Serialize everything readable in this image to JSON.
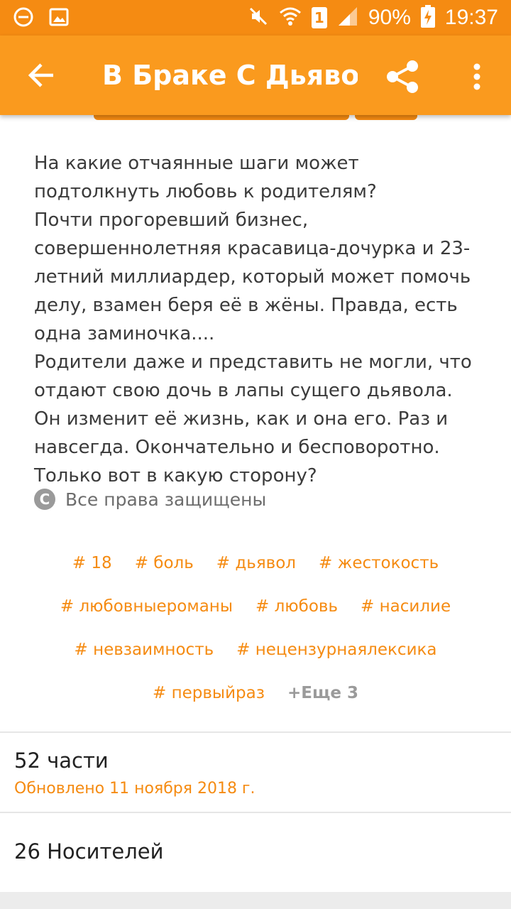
{
  "status_bar": {
    "battery": "90%",
    "time": "19:37",
    "sim_slot": "1"
  },
  "app_bar": {
    "title": "В Браке С Дьяво…"
  },
  "description": "На какие отчаянные шаги может подтолкнуть любовь к родителям?\nПочти прогоревший бизнес, совершеннолетняя красавица-дочурка и 23-летний миллиардер, который может помочь делу, взамен беря её в жёны. Правда, есть одна заминочка....\nРодители даже и представить не могли, что отдают свою дочь в лапы сущего дьявола.\nОн изменит её жизнь, как и она его. Раз и навсегда. Окончательно и бесповоротно.\nТолько вот в какую сторону?",
  "copyright": {
    "symbol": "C",
    "text": "Все права защищены"
  },
  "tags": {
    "row1": [
      "# 18",
      "# боль",
      "# дьявол",
      "# жестокость"
    ],
    "row2": [
      "# любовныеромaны",
      "# любовь",
      "# насилие"
    ],
    "row3": [
      "# невзаимность",
      "# нецензурнаялексика"
    ],
    "row4": [
      "# первыйраз"
    ],
    "more": "+Еще 3"
  },
  "parts": {
    "count": "52 части",
    "updated": "Обновлено 11 ноября 2018 г."
  },
  "media": {
    "label": "26 Носителей"
  },
  "colors": {
    "accent": "#FA9A1E",
    "status_bar": "#F58B12",
    "tag": "#F58B12"
  }
}
